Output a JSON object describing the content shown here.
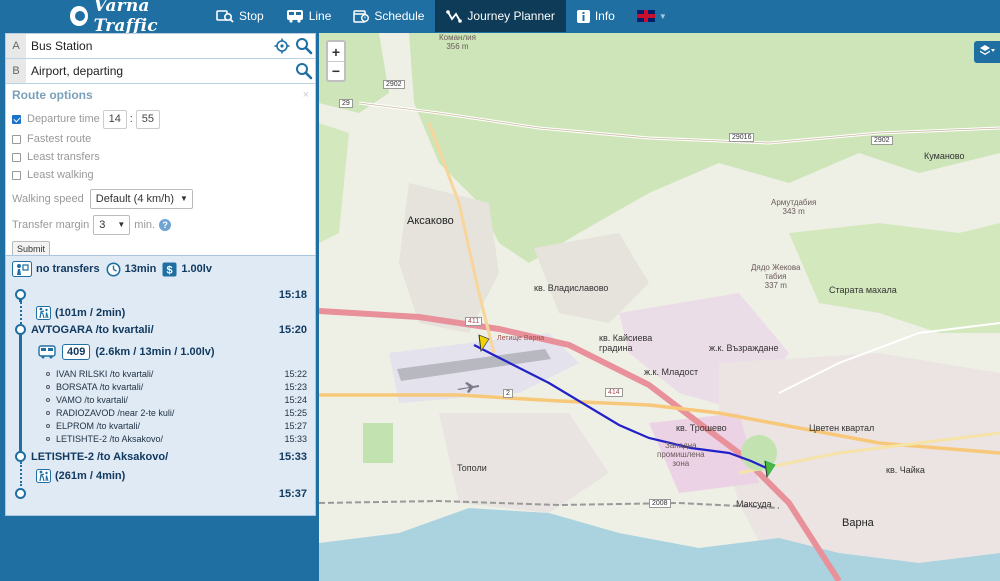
{
  "app": {
    "title": "Varna Traffic"
  },
  "nav": {
    "items": [
      {
        "label": "Stop",
        "icon": "stop-search-icon"
      },
      {
        "label": "Line",
        "icon": "bus-icon"
      },
      {
        "label": "Schedule",
        "icon": "schedule-icon"
      },
      {
        "label": "Journey Planner",
        "icon": "journey-icon",
        "active": true
      },
      {
        "label": "Info",
        "icon": "info-icon"
      }
    ],
    "language_icon": "uk-flag-icon"
  },
  "planner": {
    "a_letter": "A",
    "a_value": "Bus Station",
    "b_letter": "B",
    "b_value": "Airport, departing",
    "options": {
      "title": "Route options",
      "close": "×",
      "departure_label": "Departure time",
      "departure_checked": true,
      "hour": "14",
      "colon": ":",
      "minute": "55",
      "fastest": "Fastest route",
      "least_transfers": "Least transfers",
      "least_walking": "Least walking",
      "walking_speed_label": "Walking speed",
      "walking_speed_value": "Default (4 km/h)",
      "transfer_margin_label": "Transfer margin",
      "transfer_margin_value": "3",
      "transfer_margin_unit": "min.",
      "help": "?",
      "submit": "Submit"
    }
  },
  "result": {
    "transfers": "no transfers",
    "duration": "13min",
    "price": "1.00lv",
    "start_time": "15:18",
    "walk1": "(101m / 2min)",
    "stop1_name": "AVTOGARA /to kvartali/",
    "stop1_time": "15:20",
    "bus_number": "409",
    "bus_info": "(2.6km / 13min / 1.00lv)",
    "intermediate": [
      {
        "name": "IVAN RILSKI /to kvartali/",
        "time": "15:22"
      },
      {
        "name": "BORSATA /to kvartali/",
        "time": "15:23"
      },
      {
        "name": "VAMO /to kvartali/",
        "time": "15:24"
      },
      {
        "name": "RADIOZAVOD /near 2-te kuli/",
        "time": "15:25"
      },
      {
        "name": "ELPROM /to kvartali/",
        "time": "15:27"
      },
      {
        "name": "LETISHTE-2 /to Aksakovo/",
        "time": "15:33"
      }
    ],
    "stop2_name": "LETISHTE-2 /to Aksakovo/",
    "stop2_time": "15:33",
    "walk2": "(261m / 4min)",
    "end_time": "15:37"
  },
  "map": {
    "zoom_in": "+",
    "zoom_out": "−",
    "labels": {
      "aksakovo": "Аксаково",
      "vladislavovo": "кв. Владиславово",
      "kaysieva": "кв. Кайсиева\nградина",
      "mladost": "ж.к. Младост",
      "vazrazhdane": "ж.к. Възраждане",
      "troshevo": "кв. Трошево",
      "tsveten": "Цветен квартал",
      "chayka": "кв. Чайка",
      "varna": "Варна",
      "maksuda": "Максуда",
      "topoli": "Тополи",
      "kumanovo": "Куманово",
      "stara": "Старата махала",
      "zapadna": "Западна\nпромишлена\nзона",
      "letishte": "Летище Варна",
      "komanliya": "Команлия\n356 m",
      "armutdabia": "Армутдабия\n343 m",
      "dyado": "Дядо Жекова\nтабия\n337 m"
    },
    "shields": [
      "2902",
      "29016",
      "2902",
      "29",
      "2",
      "2008",
      "411",
      "414"
    ]
  }
}
